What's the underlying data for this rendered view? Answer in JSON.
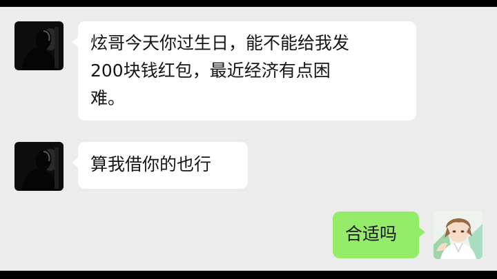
{
  "chat": {
    "messages": [
      {
        "direction": "incoming",
        "avatar": "dark-silhouette-avatar",
        "lines": [
          "炫哥今天你过生日，能不能给我发",
          "200块钱红包，最近经济有点困",
          "难。"
        ]
      },
      {
        "direction": "incoming",
        "avatar": "dark-silhouette-avatar",
        "lines": [
          "算我借你的也行"
        ]
      },
      {
        "direction": "outgoing",
        "avatar": "anime-boy-avatar",
        "lines": [
          "合适吗"
        ]
      }
    ]
  },
  "colors": {
    "background": "#ececec",
    "incoming_bubble": "#ffffff",
    "outgoing_bubble": "#95ec69",
    "text": "#141414",
    "letterbox": "#000000"
  }
}
